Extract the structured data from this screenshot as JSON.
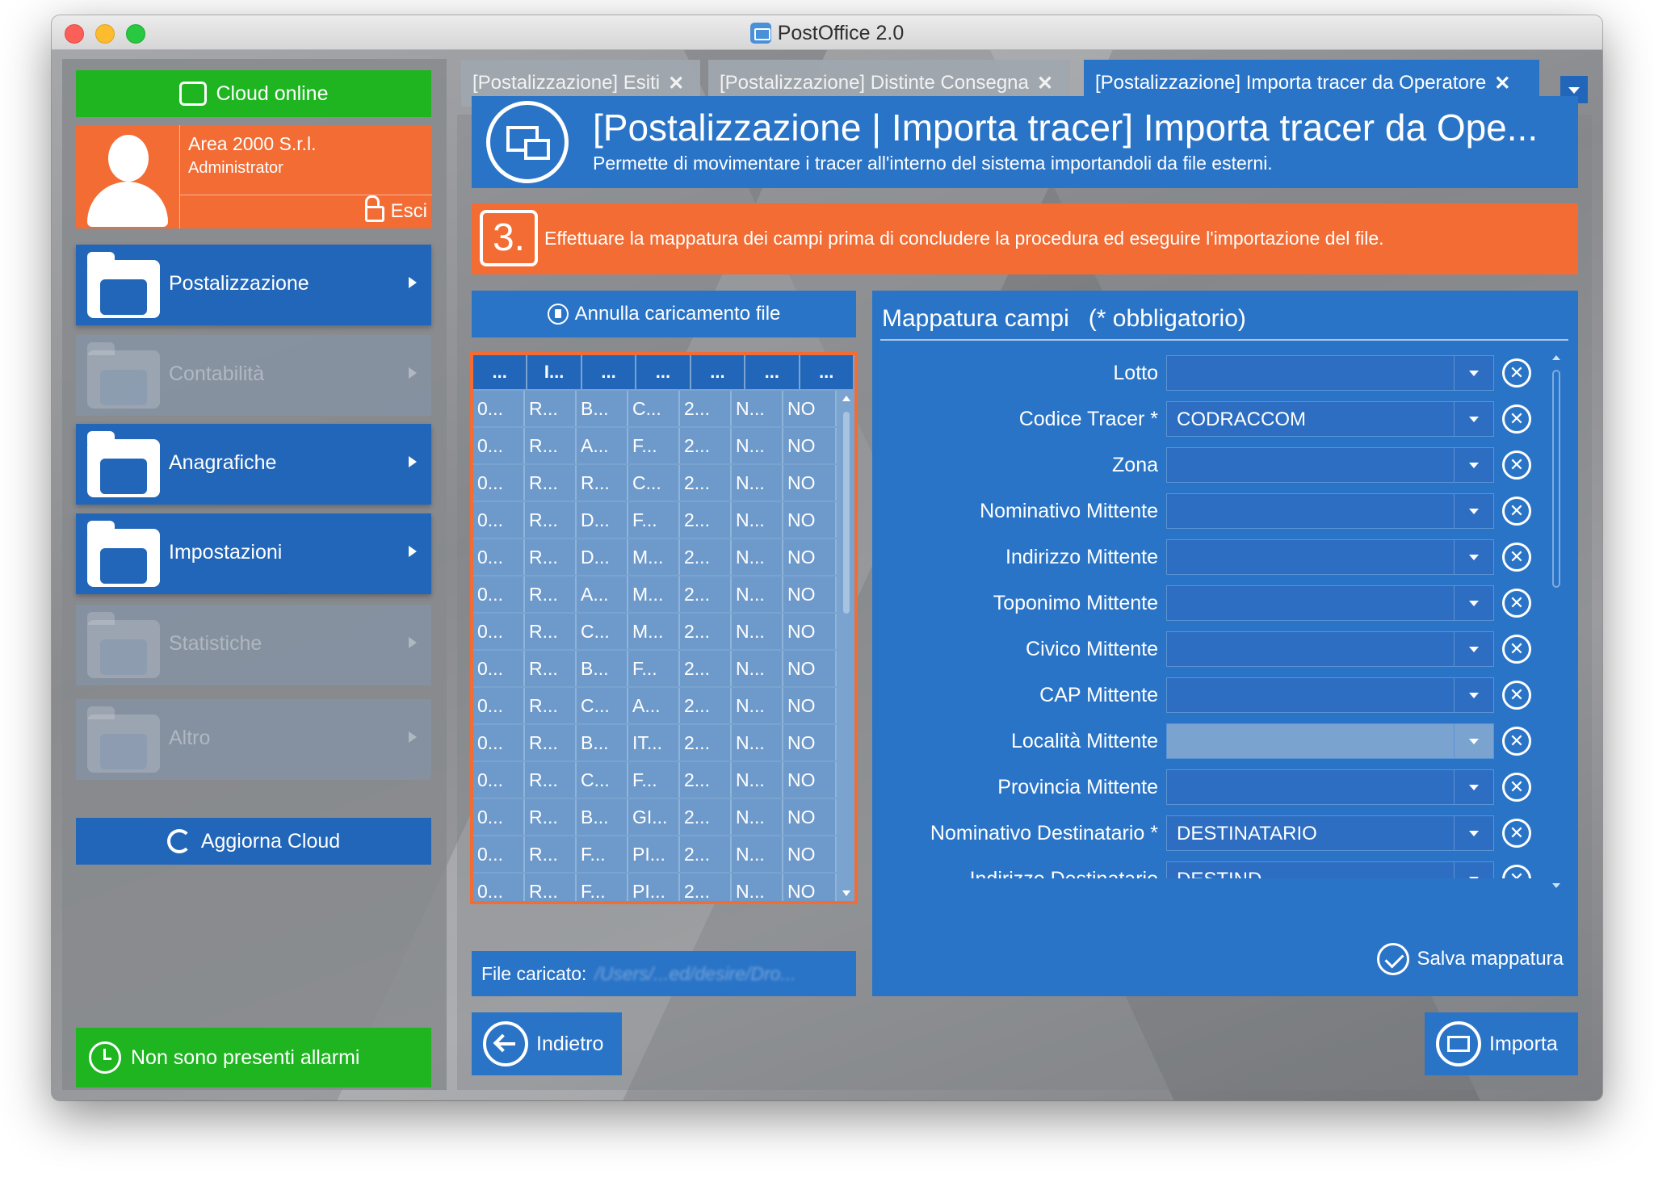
{
  "window": {
    "title": "PostOffice 2.0"
  },
  "sidebar": {
    "cloud_status": "Cloud online",
    "user": {
      "company": "Area 2000 S.r.l.",
      "role": "Administrator",
      "logout_label": "Esci"
    },
    "menu": [
      {
        "label": "Postalizzazione",
        "icon": "envelope-icon",
        "enabled": true
      },
      {
        "label": "Contabilità",
        "icon": "calculator-icon",
        "enabled": false
      },
      {
        "label": "Anagrafiche",
        "icon": "users-icon",
        "enabled": true
      },
      {
        "label": "Impostazioni",
        "icon": "gear-icon",
        "enabled": true
      },
      {
        "label": "Statistiche",
        "icon": "bar-chart-icon",
        "enabled": false
      },
      {
        "label": "Altro",
        "icon": "puzzle-icon",
        "enabled": false
      }
    ],
    "refresh_label": "Aggiorna Cloud",
    "alarm_status": "Non sono presenti allarmi"
  },
  "tabs": [
    {
      "label": "[Postalizzazione] Esiti",
      "active": false
    },
    {
      "label": "[Postalizzazione] Distinte Consegna",
      "active": false
    },
    {
      "label": "[Postalizzazione] Importa tracer da Operatore",
      "active": true
    }
  ],
  "tab_close_glyph": "✕",
  "header": {
    "title": "[Postalizzazione | Importa tracer] Importa tracer da Ope...",
    "subtitle": "Permette di movimentare i tracer all'interno del sistema importandoli da file esterni."
  },
  "step": {
    "number": "3.",
    "text": "Effettuare la mappatura dei campi prima di concludere la procedura ed eseguire l'importazione del file."
  },
  "file_panel": {
    "cancel_label": "Annulla caricamento file",
    "columns": [
      "...",
      "I...",
      "...",
      "...",
      "...",
      "...",
      "..."
    ],
    "rows": [
      [
        "0...",
        "R...",
        "B...",
        "C...",
        "2...",
        "N...",
        "NO"
      ],
      [
        "0...",
        "R...",
        "A...",
        "F...",
        "2...",
        "N...",
        "NO"
      ],
      [
        "0...",
        "R...",
        "R...",
        "C...",
        "2...",
        "N...",
        "NO"
      ],
      [
        "0...",
        "R...",
        "D...",
        "F...",
        "2...",
        "N...",
        "NO"
      ],
      [
        "0...",
        "R...",
        "D...",
        "M...",
        "2...",
        "N...",
        "NO"
      ],
      [
        "0...",
        "R...",
        "A...",
        "M...",
        "2...",
        "N...",
        "NO"
      ],
      [
        "0...",
        "R...",
        "C...",
        "M...",
        "2...",
        "N...",
        "NO"
      ],
      [
        "0...",
        "R...",
        "B...",
        "F...",
        "2...",
        "N...",
        "NO"
      ],
      [
        "0...",
        "R...",
        "C...",
        "A...",
        "2...",
        "N...",
        "NO"
      ],
      [
        "0...",
        "R...",
        "B...",
        "IT...",
        "2...",
        "N...",
        "NO"
      ],
      [
        "0...",
        "R...",
        "C...",
        "F...",
        "2...",
        "N...",
        "NO"
      ],
      [
        "0...",
        "R...",
        "B...",
        "GI...",
        "2...",
        "N...",
        "NO"
      ],
      [
        "0...",
        "R...",
        "F...",
        "PI...",
        "2...",
        "N...",
        "NO"
      ],
      [
        "0...",
        "R...",
        "F...",
        "PI...",
        "2...",
        "N...",
        "NO"
      ]
    ],
    "file_label": "File caricato:",
    "file_path": "/Users/...ed/desire/Dro..."
  },
  "mapping": {
    "title": "Mappatura campi",
    "required_note": "(* obbligatorio)",
    "fields": [
      {
        "label": "Lotto",
        "value": ""
      },
      {
        "label": "Codice Tracer *",
        "value": "CODRACCOM"
      },
      {
        "label": "Zona",
        "value": ""
      },
      {
        "label": "Nominativo Mittente",
        "value": ""
      },
      {
        "label": "Indirizzo Mittente",
        "value": ""
      },
      {
        "label": "Toponimo Mittente",
        "value": ""
      },
      {
        "label": "Civico Mittente",
        "value": ""
      },
      {
        "label": "CAP Mittente",
        "value": ""
      },
      {
        "label": "Località Mittente",
        "value": ""
      },
      {
        "label": "Provincia Mittente",
        "value": ""
      },
      {
        "label": "Nominativo Destinatario *",
        "value": "DESTINATARIO"
      },
      {
        "label": "Indirizzo Destinatario",
        "value": "DESTIND"
      }
    ],
    "clear_glyph": "✕",
    "save_label": "Salva mappatura"
  },
  "footer": {
    "back_label": "Indietro",
    "import_label": "Importa"
  },
  "colors": {
    "accent_blue": "#2a74c7",
    "accent_orange": "#f26c34",
    "status_green": "#1fb521"
  }
}
